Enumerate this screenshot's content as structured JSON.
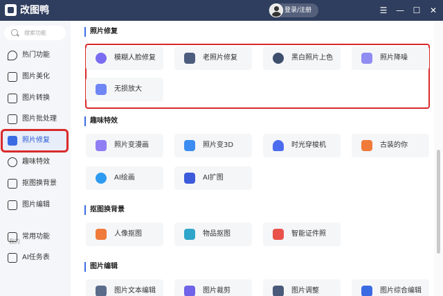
{
  "app": {
    "title": "改图鸭",
    "login_label": "登录/注册",
    "window_controls": [
      "☰",
      "—",
      "☐",
      "✕"
    ]
  },
  "sidebar": {
    "search_placeholder": "搜索功能",
    "items": [
      {
        "label": "热门功能",
        "icon": "flame-icon"
      },
      {
        "label": "图片美化",
        "icon": "image-beautify-icon"
      },
      {
        "label": "图片转换",
        "icon": "image-convert-icon"
      },
      {
        "label": "图片批处理",
        "icon": "batch-icon"
      },
      {
        "label": "照片修复",
        "icon": "photo-repair-icon",
        "active": true
      },
      {
        "label": "趣味特效",
        "icon": "sparkle-icon"
      },
      {
        "label": "抠图换背景",
        "icon": "cutout-icon"
      },
      {
        "label": "图片编辑",
        "icon": "image-edit-icon"
      }
    ],
    "mine_label": "我的",
    "mine_items": [
      {
        "label": "常用功能",
        "icon": "grid-icon"
      },
      {
        "label": "AI任务表",
        "icon": "task-list-icon"
      }
    ]
  },
  "sections": [
    {
      "title": "照片修复",
      "cards": [
        {
          "label": "模糊人脸修复",
          "color": "#7a6cf0"
        },
        {
          "label": "老照片修复",
          "color": "#4c5d7d"
        },
        {
          "label": "黑白照片上色",
          "color": "#3e4f6e"
        },
        {
          "label": "照片降噪",
          "color": "#8f8cf2"
        },
        {
          "label": "无损放大",
          "color": "#6f86f5"
        }
      ]
    },
    {
      "title": "趣味特效",
      "cards": [
        {
          "label": "照片变漫画",
          "color": "#8f7ef4"
        },
        {
          "label": "照片变3D",
          "color": "#3b8df1"
        },
        {
          "label": "时光穿梭机",
          "color": "#4c6cf0"
        },
        {
          "label": "古装的你",
          "color": "#f07a3a"
        },
        {
          "label": "AI绘画",
          "color": "#2f9bf0"
        },
        {
          "label": "AI扩图",
          "color": "#3b5bdb"
        }
      ]
    },
    {
      "title": "抠图换背景",
      "cards": [
        {
          "label": "人像抠图",
          "color": "#f07a3a"
        },
        {
          "label": "物品抠图",
          "color": "#2fa6c9"
        },
        {
          "label": "智能证件照",
          "color": "#e8524a"
        }
      ]
    },
    {
      "title": "图片编辑",
      "cards": [
        {
          "label": "图片文本编辑",
          "color": "#5b6b8a"
        },
        {
          "label": "图片裁剪",
          "color": "#6f63e8"
        },
        {
          "label": "图片调整",
          "color": "#4a5a7a"
        },
        {
          "label": "图片综合编辑",
          "color": "#3b6be3"
        }
      ]
    }
  ]
}
